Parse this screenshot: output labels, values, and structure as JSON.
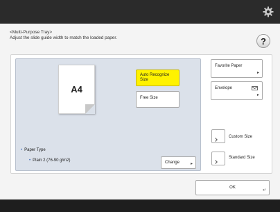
{
  "header": {
    "title": "<Multi-Purpose Tray>",
    "subtitle": "Adjust the slide guide width to match the loaded paper."
  },
  "help_label": "?",
  "paper": {
    "size": "A4"
  },
  "buttons": {
    "auto_recognize": "Auto Recognize Size",
    "free_size": "Free Size",
    "favorite_paper": "Favorite Paper",
    "envelope": "Envelope",
    "custom_size": "Custom Size",
    "standard_size": "Standard Size",
    "change": "Change",
    "ok": "OK"
  },
  "paper_type": {
    "label": "Paper Type",
    "value": "Plain 2 (76-90 g/m2)"
  },
  "icons": {
    "settings": "gear-icon",
    "help": "help-icon",
    "envelope": "envelope-icon"
  },
  "colors": {
    "selected": "#fff200",
    "top_bar": "#2b2b2b",
    "panel": "#dbe1ea",
    "bullet": "#3a66b5"
  }
}
